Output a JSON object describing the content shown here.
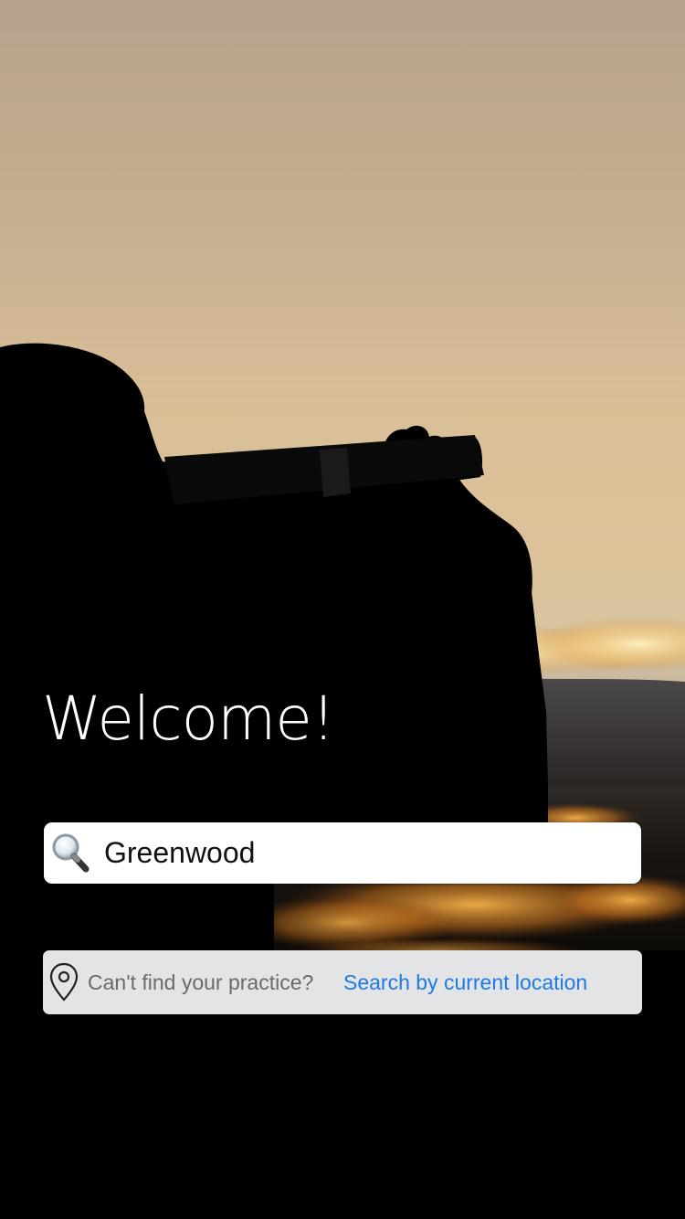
{
  "welcome": {
    "title": "Welcome!"
  },
  "search": {
    "value": "Greenwood",
    "icon": "magnifier-icon"
  },
  "location_bar": {
    "icon": "location-pin-icon",
    "prompt": "Can't find your practice?",
    "link": "Search by current location"
  },
  "colors": {
    "link": "#1e7ae6",
    "location_bar_bg": "#e3e4e6",
    "sky_top": "#b8a38a",
    "sky_mid": "#dcc095",
    "silhouette": "#000000"
  }
}
